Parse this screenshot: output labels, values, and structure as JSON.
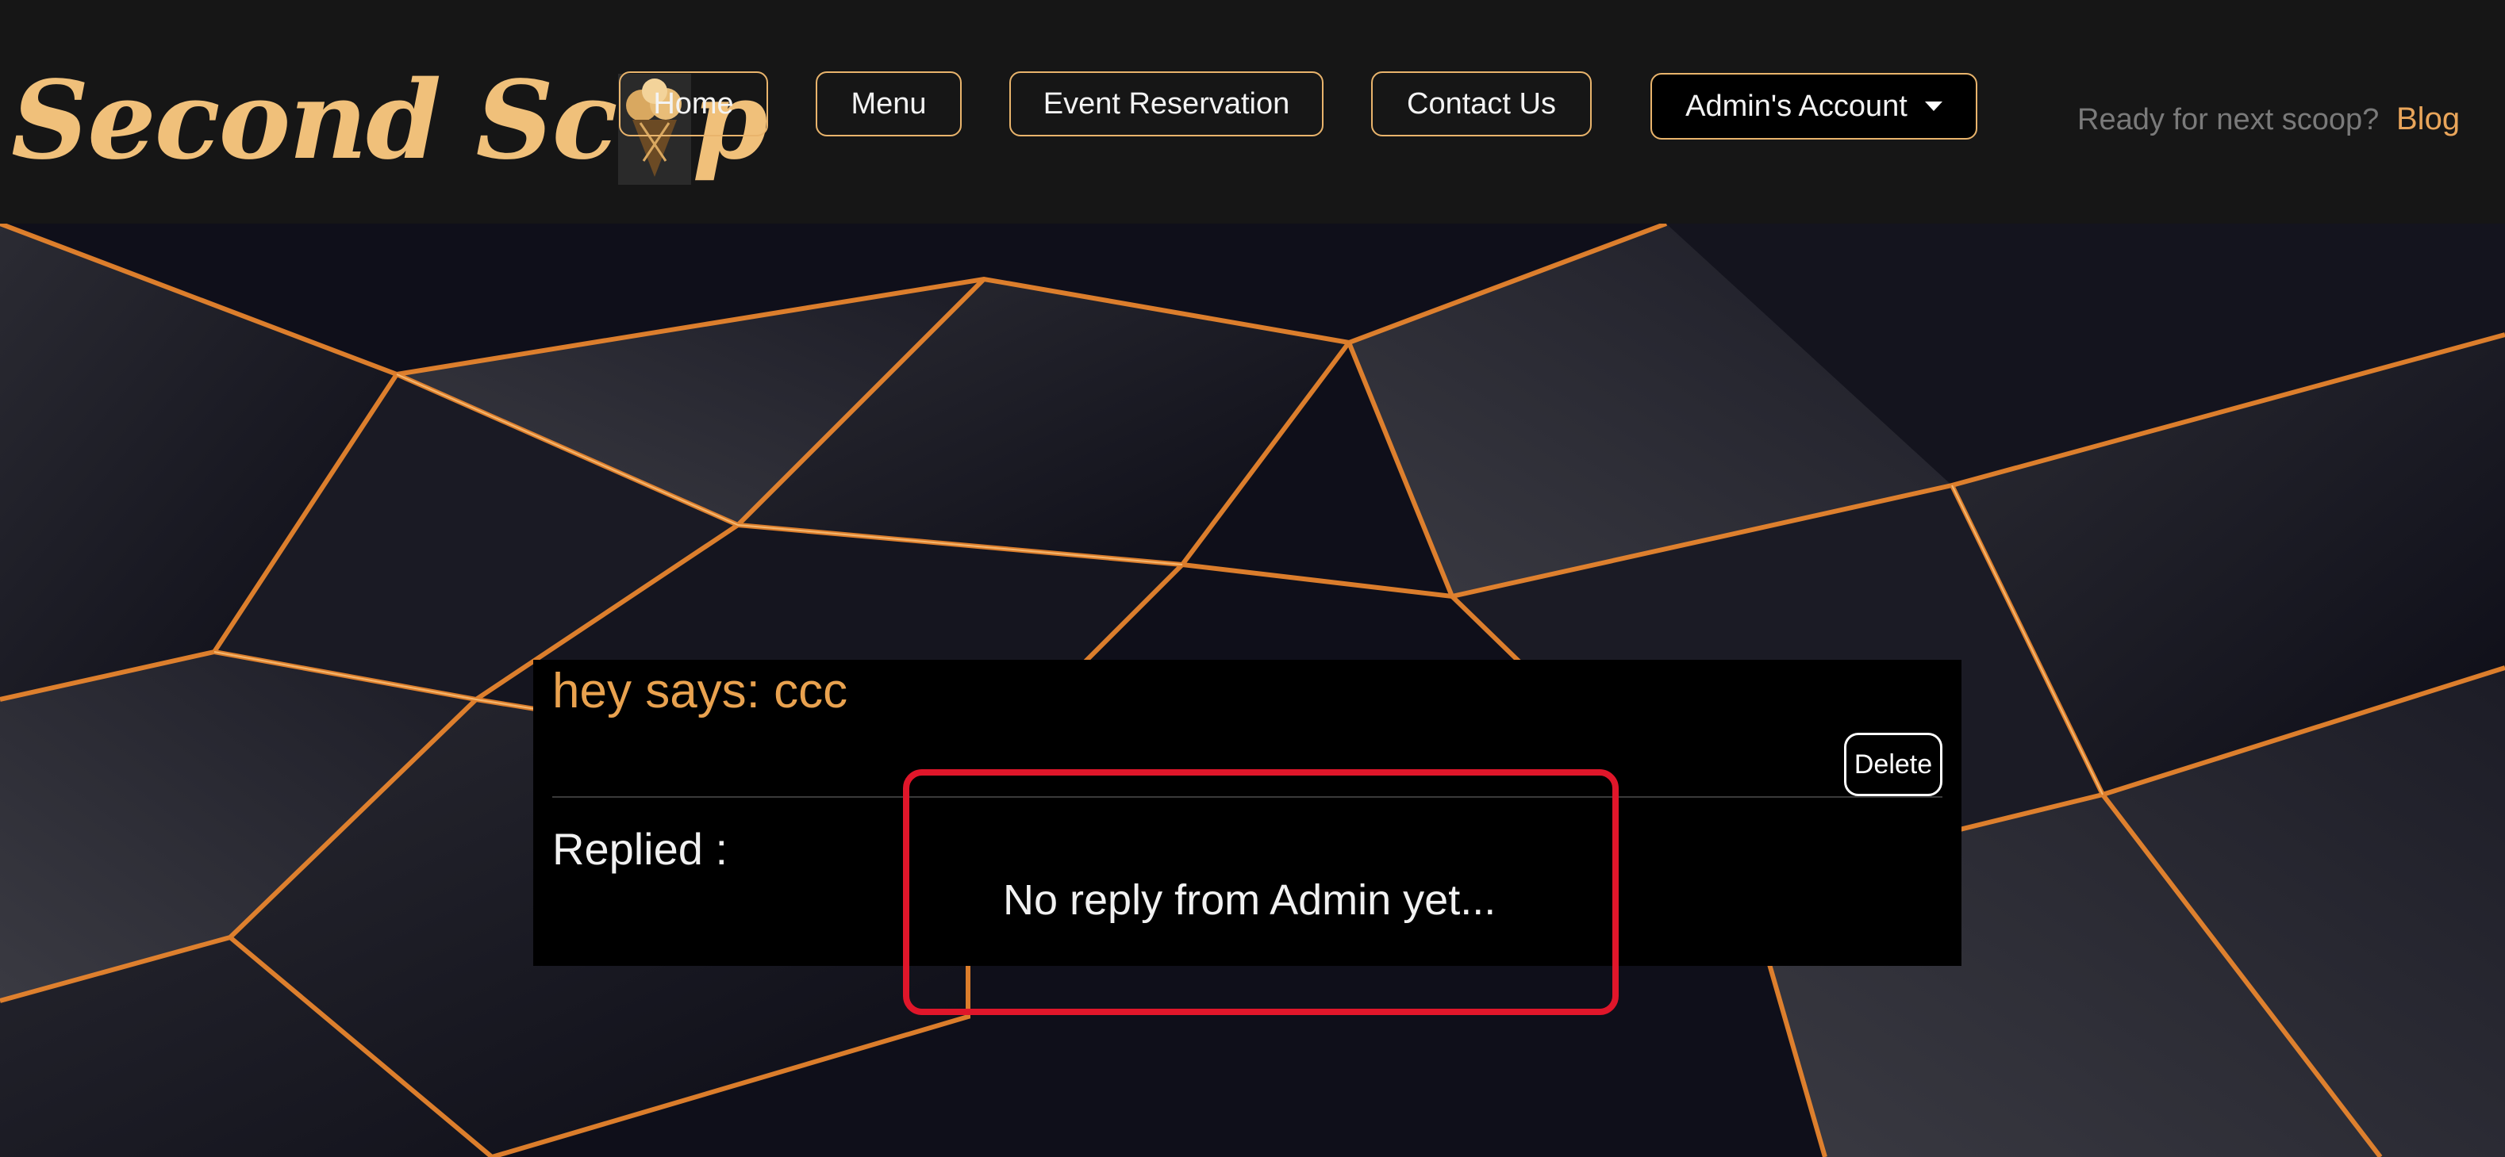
{
  "header": {
    "brand_part1": "Second Sc",
    "brand_part2": "p",
    "brand_icon": "ice-cream-cone-icon",
    "nav": {
      "home": "Home",
      "menu": "Menu",
      "event": "Event Reservation",
      "contact": "Contact Us",
      "account": "Admin's Account"
    },
    "tagline": "Ready for next scoop?",
    "blog": "Blog"
  },
  "message": {
    "title": "hey says: ccc",
    "delete_label": "Delete",
    "replied_label": "Replied :",
    "reply_text": "No reply from Admin yet..."
  },
  "colors": {
    "brand": "#f0c07a",
    "accent_orange": "#e9a24f",
    "highlight": "#e0162a",
    "navbar_bg": "#161616"
  }
}
